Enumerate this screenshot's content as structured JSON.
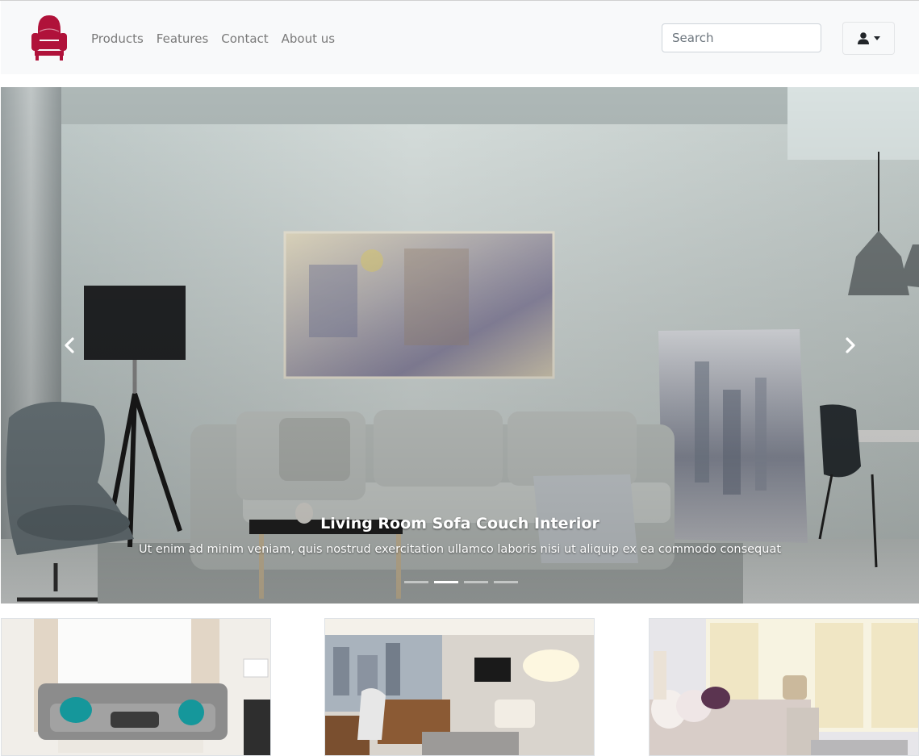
{
  "brand": {
    "logo_icon": "armchair-logo-icon",
    "color": "#b0123a"
  },
  "nav": {
    "links": [
      {
        "label": "Products"
      },
      {
        "label": "Features"
      },
      {
        "label": "Contact"
      },
      {
        "label": "About us"
      }
    ]
  },
  "search": {
    "placeholder": "Search"
  },
  "user_menu": {
    "icon": "user-icon",
    "caret_icon": "caret-down-icon"
  },
  "carousel": {
    "title": "Living Room Sofa Couch Interior",
    "text": "Ut enim ad minim veniam, quis nostrud exercitation ullamco laboris nisi ut aliquip ex ea commodo consequat",
    "slide_count": 4,
    "active_slide": 2,
    "prev_icon": "chevron-left-icon",
    "next_icon": "chevron-right-icon"
  },
  "gallery": {
    "items": [
      {
        "image": "living-room-photo"
      },
      {
        "image": "office-photo"
      },
      {
        "image": "bedroom-photo"
      }
    ]
  }
}
